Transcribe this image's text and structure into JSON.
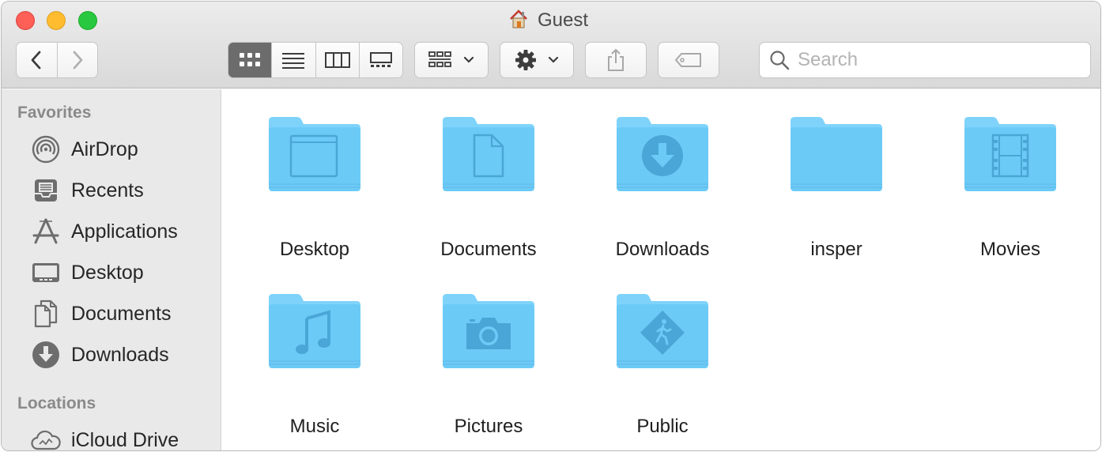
{
  "window": {
    "title": "Guest",
    "title_icon": "home-icon"
  },
  "toolbar": {
    "back_icon": "chevron-left-icon",
    "forward_icon": "chevron-right-icon",
    "view_modes": [
      "icon-view",
      "list-view",
      "column-view",
      "gallery-view"
    ],
    "active_view": "icon-view",
    "group_icon": "group-by-icon",
    "action_icon": "gear-icon",
    "share_icon": "share-icon",
    "tag_icon": "tag-icon",
    "search": {
      "placeholder": "Search",
      "value": ""
    }
  },
  "sidebar": {
    "favorites_heading": "Favorites",
    "favorites": [
      {
        "label": "AirDrop",
        "icon": "airdrop-icon"
      },
      {
        "label": "Recents",
        "icon": "recents-icon"
      },
      {
        "label": "Applications",
        "icon": "applications-icon"
      },
      {
        "label": "Desktop",
        "icon": "desktop-icon"
      },
      {
        "label": "Documents",
        "icon": "documents-icon"
      },
      {
        "label": "Downloads",
        "icon": "downloads-icon"
      }
    ],
    "locations_heading": "Locations",
    "locations": [
      {
        "label": "iCloud Drive",
        "icon": "icloud-icon"
      }
    ]
  },
  "content": {
    "items": [
      {
        "label": "Desktop",
        "icon": "desktop-folder-icon"
      },
      {
        "label": "Documents",
        "icon": "documents-folder-icon"
      },
      {
        "label": "Downloads",
        "icon": "downloads-folder-icon"
      },
      {
        "label": "insper",
        "icon": "plain-folder-icon"
      },
      {
        "label": "Movies",
        "icon": "movies-folder-icon"
      },
      {
        "label": "Music",
        "icon": "music-folder-icon"
      },
      {
        "label": "Pictures",
        "icon": "pictures-folder-icon"
      },
      {
        "label": "Public",
        "icon": "public-folder-icon"
      }
    ]
  },
  "colors": {
    "folder": "#6ccaf7",
    "folder_tab": "#7fd3fa",
    "folder_glyph": "#4aa6d6",
    "close": "#fe5f57",
    "minimize": "#febc2e",
    "maximize": "#28c840"
  }
}
